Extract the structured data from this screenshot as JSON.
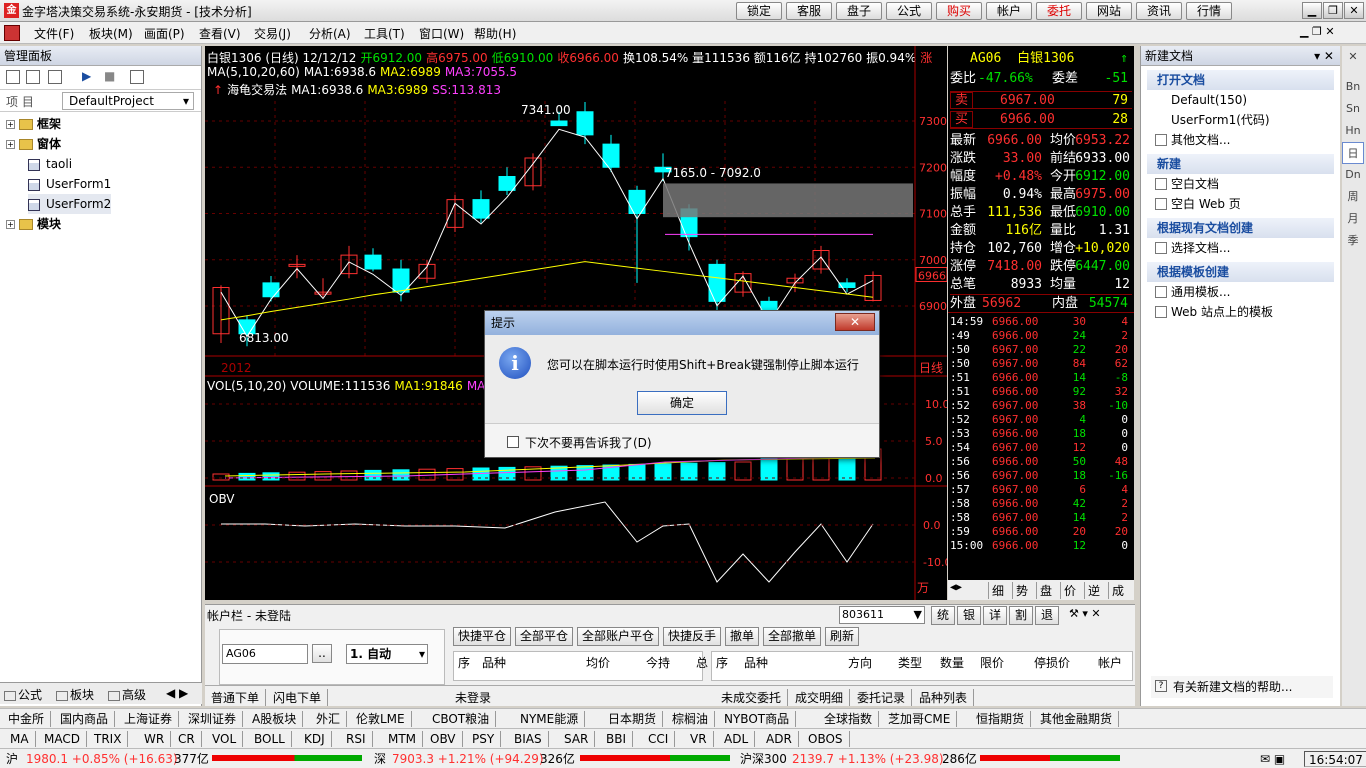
{
  "window": {
    "title": "金字塔决策交易系统-永安期货 - [技术分析]"
  },
  "toolbar_buttons": [
    "锁定",
    "客服",
    "盘子",
    "公式",
    "购买",
    "帐户",
    "委托",
    "网站",
    "资讯",
    "行情"
  ],
  "menus": [
    "文件(F)",
    "板块(M)",
    "画面(P)",
    "查看(V)",
    "交易(J)",
    "分析(A)",
    "工具(T)",
    "窗口(W)",
    "帮助(H)"
  ],
  "left_panel": {
    "title": "管理面板",
    "project_label": "项  目",
    "project_value": "DefaultProject",
    "tree": [
      {
        "label": "框架",
        "level": 0
      },
      {
        "label": "窗体",
        "level": 0
      },
      {
        "label": "taoli",
        "level": 1
      },
      {
        "label": "UserForm1",
        "level": 1
      },
      {
        "label": "UserForm2",
        "level": 1
      },
      {
        "label": "模块",
        "level": 0
      }
    ],
    "tabs": [
      "公式",
      "板块",
      "高级"
    ]
  },
  "chart": {
    "header_line1": [
      {
        "t": "白银1306 (日线) 12/12/12",
        "c": "white"
      },
      {
        "t": "开6912.00",
        "c": "green"
      },
      {
        "t": "高6975.00",
        "c": "red"
      },
      {
        "t": "低6910.00",
        "c": "green"
      },
      {
        "t": "收6966.00",
        "c": "red"
      },
      {
        "t": "换108.54% 量111536 额116亿 持102760 振0.94%",
        "c": "white"
      },
      {
        "t": "涨",
        "c": "red"
      }
    ],
    "ma_line": [
      {
        "t": "MA(5,10,20,60)",
        "c": "white"
      },
      {
        "t": "MA1:6938.6",
        "c": "white"
      },
      {
        "t": "MA2:6989",
        "c": "yel"
      },
      {
        "t": "MA3:7055.5",
        "c": "mag"
      }
    ],
    "turtle_line": [
      {
        "t": "海龟交易法",
        "c": "white"
      },
      {
        "t": "MA1:6938.6",
        "c": "white"
      },
      {
        "t": "MA3:6989",
        "c": "yel"
      },
      {
        "t": "SS:113.813",
        "c": "mag"
      }
    ],
    "annotations": {
      "high": "7341.00",
      "low": "6813.00",
      "range": "7165.0 - 7092.0",
      "year": "2012",
      "period": "日线",
      "last_price": "6966"
    },
    "price_axis": [
      "7300",
      "7200",
      "7100",
      "7000",
      "6900"
    ],
    "vol_label": [
      {
        "t": "VOL(5,10,20)",
        "c": "white"
      },
      {
        "t": "VOLUME:111536",
        "c": "white"
      },
      {
        "t": "MA1:91846",
        "c": "yel"
      },
      {
        "t": "MA",
        "c": "mag"
      }
    ],
    "vol_axis": [
      "10.0",
      "5.0",
      "0.0"
    ],
    "obv_label": "OBV",
    "obv_axis": [
      "0.0",
      "-10.0"
    ],
    "obv_unit": "万"
  },
  "quote": {
    "code": "AG06",
    "name": "白银1306",
    "weibi_label": "委比",
    "weibi": "-47.66%",
    "weicha_label": "委差",
    "weicha": "-51",
    "sell_label": "卖",
    "sell_price": "6967.00",
    "sell_vol": "79",
    "buy_label": "买",
    "buy_price": "6966.00",
    "buy_vol": "28",
    "rows": [
      [
        "最新",
        "6966.00",
        "均价",
        "6953.22"
      ],
      [
        "涨跌",
        "33.00",
        "前结",
        "6933.00"
      ],
      [
        "幅度",
        "+0.48%",
        "今开",
        "6912.00"
      ],
      [
        "振幅",
        "0.94%",
        "最高",
        "6975.00"
      ],
      [
        "总手",
        "111,536",
        "最低",
        "6910.00"
      ],
      [
        "金额",
        "116亿",
        "量比",
        "1.31"
      ],
      [
        "持仓",
        "102,760",
        "增仓",
        "+10,020"
      ],
      [
        "涨停",
        "7418.00",
        "跌停",
        "6447.00"
      ],
      [
        "总笔",
        "8933",
        "均量",
        "12"
      ]
    ],
    "outer_label": "外盘",
    "outer": "56962",
    "inner_label": "内盘",
    "inner": "54574",
    "ticks": [
      [
        "14:59",
        "6966.00",
        "30",
        "4"
      ],
      [
        ":49",
        "6966.00",
        "24",
        "2"
      ],
      [
        ":50",
        "6967.00",
        "22",
        "20"
      ],
      [
        ":50",
        "6967.00",
        "84",
        "62"
      ],
      [
        ":51",
        "6966.00",
        "14",
        "-8"
      ],
      [
        ":51",
        "6966.00",
        "92",
        "32"
      ],
      [
        ":52",
        "6967.00",
        "38",
        "-10"
      ],
      [
        ":52",
        "6967.00",
        "4",
        "0"
      ],
      [
        ":53",
        "6966.00",
        "18",
        "0"
      ],
      [
        ":54",
        "6967.00",
        "12",
        "0"
      ],
      [
        ":56",
        "6966.00",
        "50",
        "48"
      ],
      [
        ":56",
        "6967.00",
        "18",
        "-16"
      ],
      [
        ":57",
        "6967.00",
        "6",
        "4"
      ],
      [
        ":58",
        "6966.00",
        "42",
        "2"
      ],
      [
        ":58",
        "6967.00",
        "14",
        "2"
      ],
      [
        ":59",
        "6966.00",
        "20",
        "20"
      ],
      [
        "15:00",
        "6966.00",
        "12",
        "0"
      ]
    ],
    "tabs": [
      "细",
      "势",
      "盘",
      "价",
      "逆",
      "成"
    ]
  },
  "right_panel": {
    "title": "新建文档",
    "sections": [
      {
        "title": "打开文档",
        "items": [
          "Default(150)",
          "UserForm1(代码)",
          "其他文档..."
        ]
      },
      {
        "title": "新建",
        "items": [
          "空白文档",
          "空白 Web 页"
        ]
      },
      {
        "title": "根据现有文档创建",
        "items": [
          "选择文档..."
        ]
      },
      {
        "title": "根据模板创建",
        "items": [
          "通用模板...",
          "Web 站点上的模板"
        ]
      }
    ],
    "help": "有关新建文档的帮助..."
  },
  "vtabs": [
    "Bn",
    "Sn",
    "Hn",
    "日",
    "Dn",
    "周",
    "月",
    "季"
  ],
  "account": {
    "title": "帐户栏  -  未登陆",
    "account_code": "803611",
    "mini_buttons": [
      "统",
      "银",
      "详",
      "割",
      "退"
    ],
    "symbol": "AG06",
    "mode": "1. 自动",
    "actions": [
      "快捷平仓",
      "全部平仓",
      "全部账户平仓",
      "快捷反手",
      "撤单",
      "全部撤单",
      "刷新"
    ],
    "left_cols": [
      "序",
      "品种",
      "均价",
      "今持",
      "总"
    ],
    "right_cols": [
      "序",
      "品种",
      "方向",
      "类型",
      "数量",
      "限价",
      "停损价",
      "帐户"
    ],
    "left_tabs": [
      "普通下单",
      "闪电下单"
    ],
    "status": "未登录",
    "right_tabs": [
      "未成交委托",
      "成交明细",
      "委托记录",
      "品种列表"
    ]
  },
  "market_tabs": [
    "中金所",
    "国内商品",
    "上海证券",
    "深圳证券",
    "A股板块",
    "外汇",
    "伦敦LME",
    "CBOT粮油",
    "NYME能源",
    "日本期货",
    "棕榈油",
    "NYBOT商品",
    "全球指数",
    "芝加哥CME",
    "恒指期货",
    "其他金融期货"
  ],
  "indicators": [
    "MA",
    "MACD",
    "TRIX",
    "WR",
    "CR",
    "VOL",
    "BOLL",
    "KDJ",
    "RSI",
    "MTM",
    "OBV",
    "PSY",
    "BIAS",
    "SAR",
    "BBI",
    "CCI",
    "VR",
    "ADL",
    "ADR",
    "OBOS"
  ],
  "status_bar": {
    "sh_label": "沪",
    "sh": "1980.1 +0.85% (+16.63)",
    "sh_amt": "377亿",
    "sz_label": "深",
    "sz": "7903.3 +1.21% (+94.29)",
    "sz_amt": "326亿",
    "hs_label": "沪深300",
    "hs": "2139.7 +1.13% (+23.98)",
    "hs_amt": "286亿",
    "time": "16:54:07"
  },
  "dialog": {
    "title": "提示",
    "message": "您可以在脚本运行时使用Shift+Break键强制停止脚本运行",
    "ok": "确定",
    "checkbox": "下次不要再告诉我了(D)"
  }
}
